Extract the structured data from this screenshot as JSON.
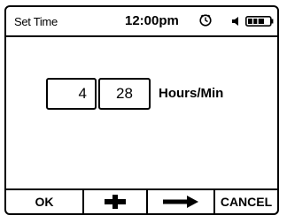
{
  "status_bar": {
    "title": "Set Time",
    "clock": "12:00pm",
    "alarm_icon": "clock-icon",
    "speaker_icon": "speaker-icon",
    "battery_icon": "battery-icon",
    "battery_level": 0.75
  },
  "time_entry": {
    "hours": "4",
    "minutes": "28",
    "unit_label": "Hours/Min"
  },
  "softkeys": {
    "ok_label": "OK",
    "plus_icon": "plus-icon",
    "next_icon": "arrow-right-icon",
    "cancel_label": "CANCEL"
  }
}
